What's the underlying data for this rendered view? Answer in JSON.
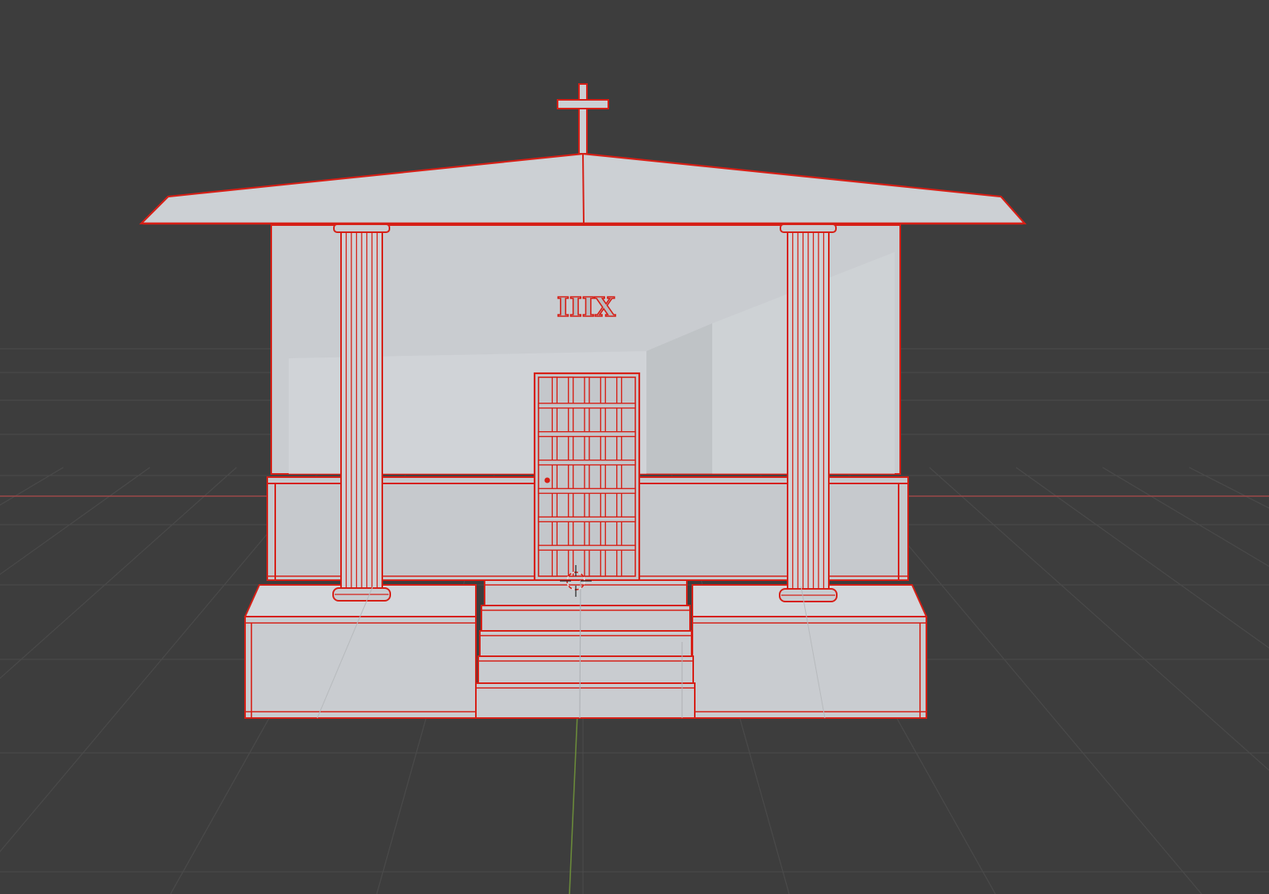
{
  "app": "3D Viewport",
  "viewport": {
    "background": "#3d3d3d",
    "grid_color": "#4a4a4a",
    "x_axis_color": "#9c4848",
    "y_axis_color": "#6a8a3a"
  },
  "model": {
    "name": "mausoleum",
    "selected": true,
    "display_mode": "solid",
    "fill_color": "#c9ccd0",
    "shade_color": "#b9bcc0",
    "outline_color": "#d61f16",
    "inscription": "IIIX",
    "symbol": "cross-icon"
  },
  "cursor": {
    "name": "3d-cursor"
  }
}
